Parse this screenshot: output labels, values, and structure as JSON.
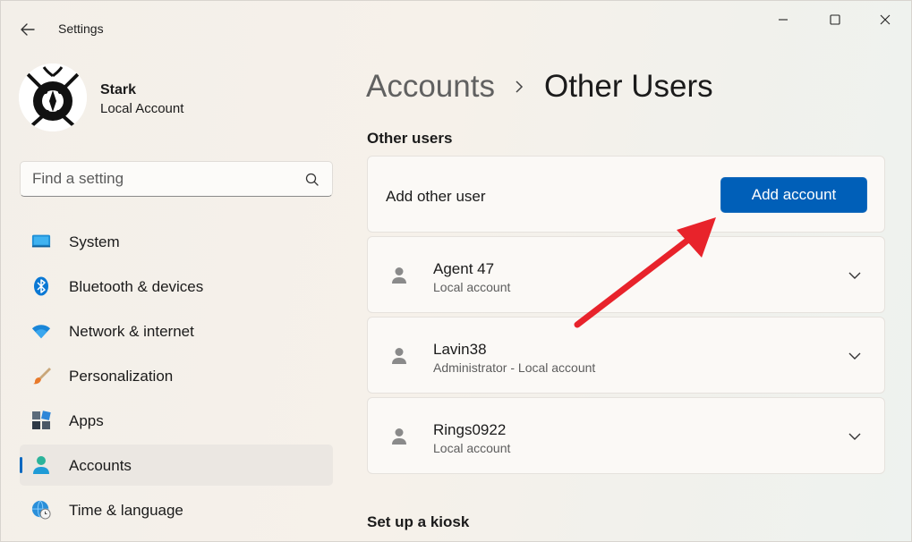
{
  "window": {
    "title": "Settings",
    "controls": {
      "minimize": "minimize-icon",
      "maximize": "maximize-icon",
      "close": "close-icon"
    }
  },
  "profile": {
    "name": "Stark",
    "account_type": "Local Account"
  },
  "search": {
    "placeholder": "Find a setting"
  },
  "sidebar": {
    "items": [
      {
        "label": "System",
        "icon": "system-icon",
        "active": false
      },
      {
        "label": "Bluetooth & devices",
        "icon": "bluetooth-icon",
        "active": false
      },
      {
        "label": "Network & internet",
        "icon": "wifi-icon",
        "active": false
      },
      {
        "label": "Personalization",
        "icon": "brush-icon",
        "active": false
      },
      {
        "label": "Apps",
        "icon": "apps-icon",
        "active": false
      },
      {
        "label": "Accounts",
        "icon": "accounts-icon",
        "active": true
      },
      {
        "label": "Time & language",
        "icon": "globe-clock-icon",
        "active": false
      }
    ]
  },
  "breadcrumb": {
    "parent": "Accounts",
    "current": "Other Users"
  },
  "other_users": {
    "section_title": "Other users",
    "add_label": "Add other user",
    "add_button": "Add account",
    "users": [
      {
        "name": "Agent 47",
        "type": "Local account"
      },
      {
        "name": "Lavin38",
        "type": "Administrator - Local account"
      },
      {
        "name": "Rings0922",
        "type": "Local account"
      }
    ]
  },
  "kiosk": {
    "section_title": "Set up a kiosk"
  },
  "colors": {
    "accent": "#005fb8",
    "annotation_arrow": "#e8232b"
  }
}
